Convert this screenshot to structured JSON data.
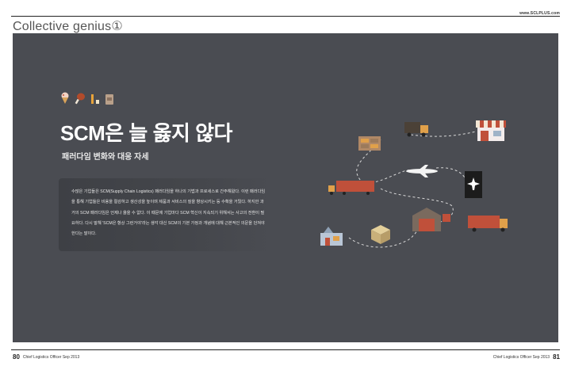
{
  "header": {
    "site_url": "www.SCLPLUS.com",
    "section_title": "Collective genius①"
  },
  "article": {
    "headline": "SCM은 늘 옳지 않다",
    "subhead": "패러다임 변화와 대응 자세",
    "body": "수많은 기업들은 SCM(Supply Chain Logistics) 패러다임을 하나의 기법과 프로세스로 간주해왔다. 이런 패러다임을 통해 기업들은 비용을 절감하고 생산성을 높이며 제품과 서비스의 질을 향상시키는 등 수확을 거뒀다. 하지만 과거의 SCM 패러다임은 언제나 옳을 수 없다. 이 때문에 기업마다 SCM 혁신이 지속되기 위해서는 사고의 전환이 필요하다. 다시 말해 'SCM은 항상 그런거야'라는 생각 대신 SCM의 기본 가정과 개념에 대해 근본적인 의문을 던져야 한다는 말이다."
  },
  "footer": {
    "left_page": "80",
    "left_text": "Chief Logistics Officer Sep 2013",
    "right_text": "Chief Logistics Officer Sep 2013",
    "right_page": "81"
  },
  "icons": [
    "ice-cream-icon",
    "drumstick-icon",
    "bottle-icon",
    "bag-icon",
    "truck-icon",
    "store-icon",
    "warehouse-icon",
    "airplane-icon",
    "airport-sign-icon",
    "container-truck-icon",
    "box-icon",
    "factory-icon"
  ],
  "colors": {
    "panel": "#4a4c52",
    "accent_orange": "#e0a04a",
    "accent_red": "#c0503a"
  }
}
